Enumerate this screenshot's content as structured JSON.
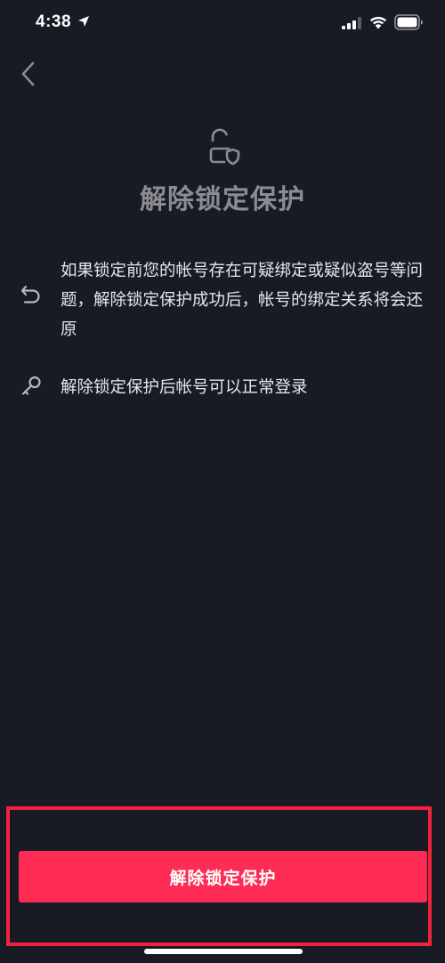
{
  "status_bar": {
    "time": "4:38",
    "icons": [
      "location-arrow-icon",
      "cellular-signal-icon",
      "wifi-icon",
      "battery-icon"
    ]
  },
  "header": {
    "back_icon": "chevron-left-icon",
    "hero_icon": "unlock-shield-icon",
    "title": "解除锁定保护"
  },
  "info_items": [
    {
      "icon": "undo-arrow-icon",
      "text": "如果锁定前您的帐号存在可疑绑定或疑似盗号等问题，解除锁定保护成功后，帐号的绑定关系将会还原"
    },
    {
      "icon": "key-icon",
      "text": "解除锁定保护后帐号可以正常登录"
    }
  ],
  "footer": {
    "button_label": "解除锁定保护"
  },
  "colors": {
    "background": "#181a24",
    "accent": "#fe2c55",
    "highlight_frame": "#f2223f",
    "title_gray": "#8b8c92",
    "body_text": "#e6e6ea"
  }
}
